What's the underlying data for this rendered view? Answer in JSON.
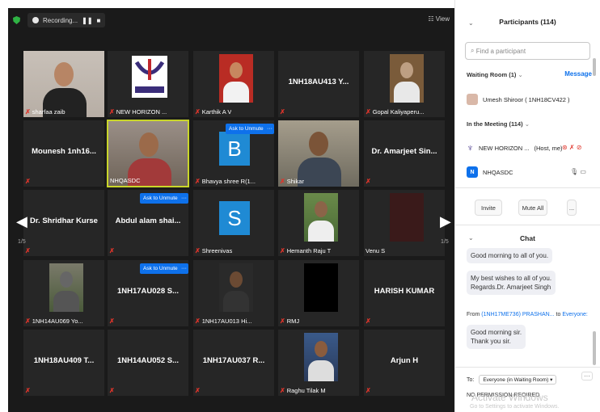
{
  "topbar": {
    "recording": "Recording...",
    "pause": "❚❚",
    "stop": "■",
    "view": "☷ View"
  },
  "grid": {
    "tiles": [
      {
        "name": "sharfaa zaib",
        "muted": true
      },
      {
        "name": "NEW HORIZON ...",
        "muted": true
      },
      {
        "name": "Karthik A V",
        "muted": true
      },
      {
        "center": "1NH18AU413 Y...",
        "muted": true
      },
      {
        "name": "Gopal Kaliyaperu...",
        "muted": true
      },
      {
        "center": "Mounesh 1nh16...",
        "muted": true
      },
      {
        "name": "NHQASDC",
        "muted": false
      },
      {
        "name": "Bhavya shree R(1...",
        "muted": true,
        "letter": "B",
        "unmute": "Ask to Unmute",
        "more": "···"
      },
      {
        "name": "Shikar",
        "muted": true
      },
      {
        "center": "Dr. Amarjeet Sin...",
        "muted": true
      },
      {
        "center": "Dr. Shridhar Kurse",
        "muted": true
      },
      {
        "center": "Abdul alam shai...",
        "muted": true,
        "unmute": "Ask to Unmute",
        "more": "···"
      },
      {
        "name": "Shreenivas",
        "muted": true,
        "letter": "S"
      },
      {
        "name": "Hemanth Raju T",
        "muted": true
      },
      {
        "name": "Venu S",
        "muted": false
      },
      {
        "name": "1NH14AU069 Yo...",
        "muted": true
      },
      {
        "center": "1NH17AU028 S...",
        "muted": true,
        "unmute": "Ask to Unmute",
        "more": "···"
      },
      {
        "name": "1NH17AU013 Hi...",
        "muted": true
      },
      {
        "name": "RMJ",
        "muted": true
      },
      {
        "center": "HARISH KUMAR",
        "muted": true
      },
      {
        "center": "1NH18AU409 T...",
        "muted": true
      },
      {
        "center": "1NH14AU052 S...",
        "muted": true
      },
      {
        "center": "1NH17AU037 R...",
        "muted": true
      },
      {
        "name": "Raghu Tilak M",
        "muted": true
      },
      {
        "center": "Arjun H",
        "muted": true
      }
    ],
    "page_left": "1/5",
    "page_right": "1/5",
    "mic_glyph": "✗"
  },
  "participants": {
    "title": "Participants (114)",
    "search_placeholder": "Find a participant",
    "waiting_room": "Waiting Room (1)",
    "message": "Message",
    "waiting_name": "Umesh Shiroor ( 1NH18CV422 )",
    "in_meeting": "In the Meeting (114)",
    "host_name": "NEW HORIZON ...",
    "host_tag": "(Host, me)",
    "member_initial": "N",
    "member_name": "NHQASDC",
    "invite": "Invite",
    "mute_all": "Mute All",
    "more": "..."
  },
  "chat": {
    "title": "Chat",
    "msg1": "Good morning to all of you.",
    "msg2a": "My best wishes to all of you.",
    "msg2b": "Regards.Dr. Amarjeet Singh",
    "from_prefix": "From",
    "from_name": "(1NH17ME736) PRASHAN...",
    "from_to": "to",
    "from_target": "Everyone:",
    "msg3a": "Good morning sir.",
    "msg3b": "Thank you sir.",
    "to_label": "To:",
    "to_value": "Everyone (in Waiting Room) ▾",
    "permission": "NO PERMISSION REQIRED",
    "watermark": "Activate Windows",
    "watermark_sub": "Go to Settings to activate Windows."
  },
  "colors": {
    "accent": "#0e71eb",
    "mute": "#e0352b",
    "active_border": "#c9d62a"
  }
}
